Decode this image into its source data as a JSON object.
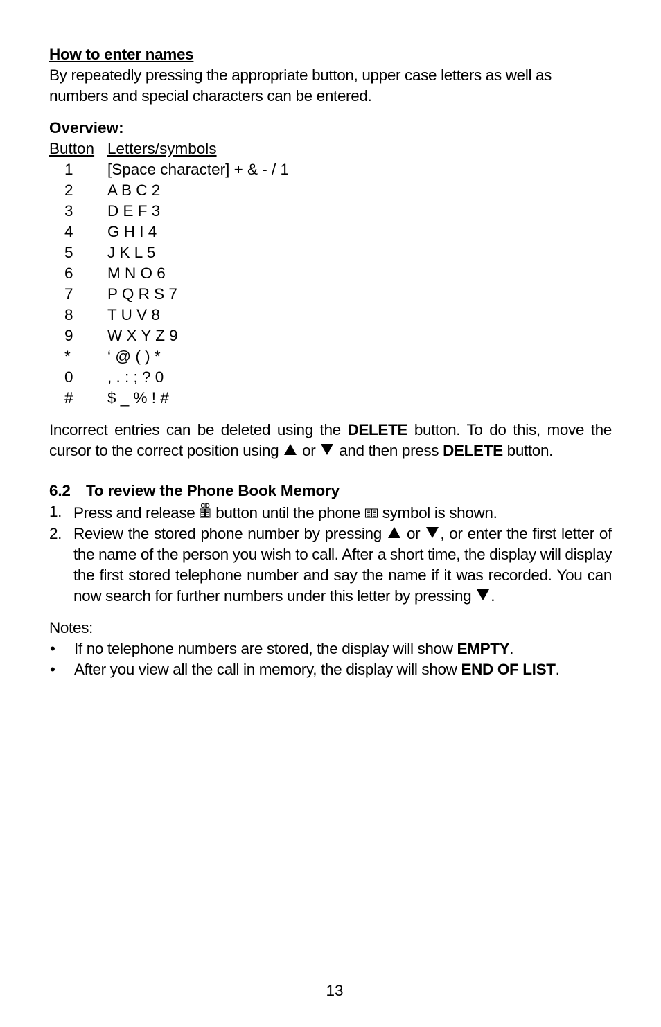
{
  "section_enter_names": {
    "heading": "How to enter names",
    "intro": "By repeatedly pressing the appropriate button, upper case letters as well as numbers and special characters can be entered."
  },
  "overview": {
    "title": "Overview:",
    "header_button": "Button",
    "header_symbols": "Letters/symbols",
    "rows": [
      {
        "button": "1",
        "symbols": "[Space character] + & - / 1"
      },
      {
        "button": "2",
        "symbols": "A B C 2"
      },
      {
        "button": "3",
        "symbols": "D E F 3"
      },
      {
        "button": "4",
        "symbols": "G H I 4"
      },
      {
        "button": "5",
        "symbols": "J K L 5"
      },
      {
        "button": "6",
        "symbols": "M N O 6"
      },
      {
        "button": "7",
        "symbols": "P Q R S 7"
      },
      {
        "button": "8",
        "symbols": "T U V 8"
      },
      {
        "button": "9",
        "symbols": "W X Y Z 9"
      },
      {
        "button": "*",
        "symbols": "‘ @ ( ) *"
      },
      {
        "button": "0",
        "symbols": ", . : ; ? 0"
      },
      {
        "button": "#",
        "symbols": "$ _ % ! #"
      }
    ]
  },
  "delete_para": {
    "part1": "Incorrect entries can be deleted using the ",
    "bold1": "DELETE",
    "part2": " button. To do this, move the cursor to the correct position using ",
    "part3": " or ",
    "part4": " and then press ",
    "bold2": "DELETE",
    "part5": " button."
  },
  "section_6_2": {
    "number": "6.2",
    "title": "To review the Phone Book Memory",
    "cid_label": "CID",
    "steps": [
      {
        "marker": "1.",
        "part1": "Press and release ",
        "part2": " button until the phone ",
        "part3": " symbol is shown."
      },
      {
        "marker": "2.",
        "part1": "Review the stored phone number by pressing ",
        "part2": " or ",
        "part3": ", or enter the first letter of the name of the person you wish to call. After a short time, the display will display the first stored telephone number and say the name if it was recorded. You can now search for further numbers under this letter by pressing ",
        "part4": "."
      }
    ]
  },
  "notes": {
    "title": "Notes:",
    "items": [
      {
        "marker": "•",
        "text": "If no telephone numbers are stored, the display will show ",
        "bold": "EMPTY",
        "end": "."
      },
      {
        "marker": "•",
        "text": "After you view all the call in memory, the display will show ",
        "bold": "END OF LIST",
        "end": "."
      }
    ]
  },
  "page_number": "13"
}
